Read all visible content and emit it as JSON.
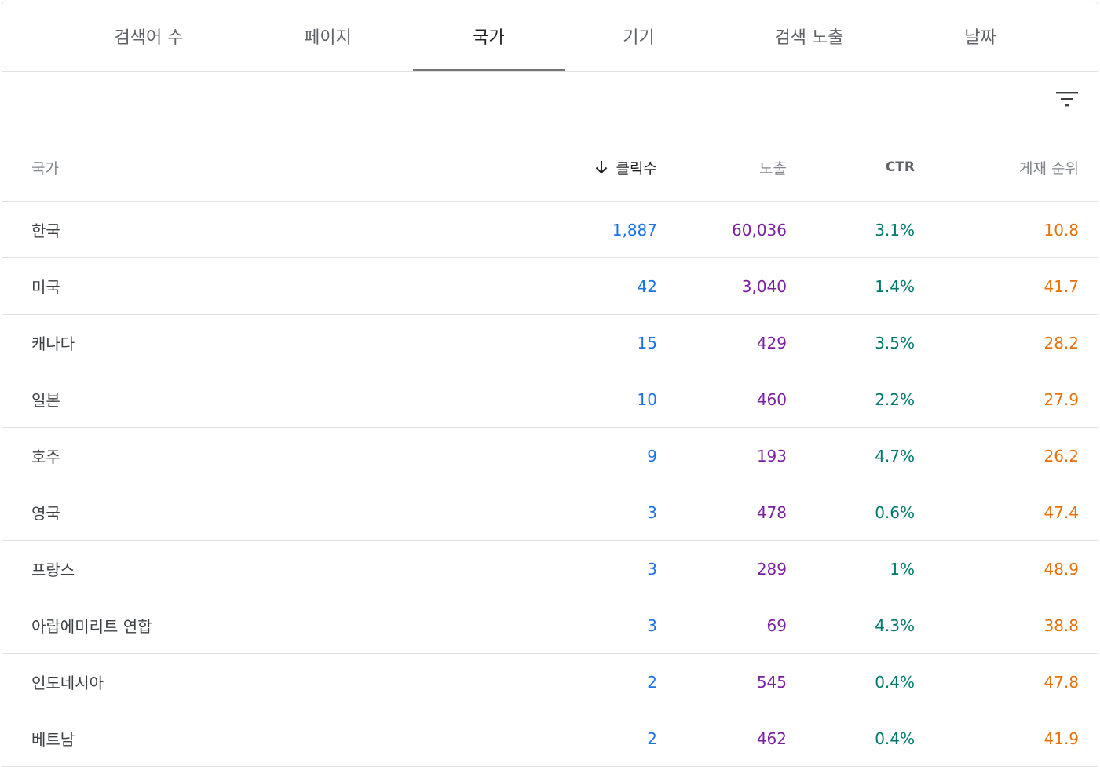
{
  "tabs": [
    {
      "label": "검색어 수",
      "active": false
    },
    {
      "label": "페이지",
      "active": false
    },
    {
      "label": "국가",
      "active": true
    },
    {
      "label": "기기",
      "active": false
    },
    {
      "label": "검색 노출",
      "active": false
    },
    {
      "label": "날짜",
      "active": false
    }
  ],
  "toolbar": {
    "filter_icon": "filter-icon"
  },
  "table": {
    "columns": {
      "country": "국가",
      "clicks": "클릭수",
      "impressions": "노출",
      "ctr": "CTR",
      "position": "게재 순위"
    },
    "sort": {
      "column": "clicks",
      "direction": "descending",
      "icon": "arrow-down-icon"
    },
    "rows": [
      {
        "country": "한국",
        "clicks": "1,887",
        "impressions": "60,036",
        "ctr": "3.1%",
        "position": "10.8"
      },
      {
        "country": "미국",
        "clicks": "42",
        "impressions": "3,040",
        "ctr": "1.4%",
        "position": "41.7"
      },
      {
        "country": "캐나다",
        "clicks": "15",
        "impressions": "429",
        "ctr": "3.5%",
        "position": "28.2"
      },
      {
        "country": "일본",
        "clicks": "10",
        "impressions": "460",
        "ctr": "2.2%",
        "position": "27.9"
      },
      {
        "country": "호주",
        "clicks": "9",
        "impressions": "193",
        "ctr": "4.7%",
        "position": "26.2"
      },
      {
        "country": "영국",
        "clicks": "3",
        "impressions": "478",
        "ctr": "0.6%",
        "position": "47.4"
      },
      {
        "country": "프랑스",
        "clicks": "3",
        "impressions": "289",
        "ctr": "1%",
        "position": "48.9"
      },
      {
        "country": "아랍에미리트 연합",
        "clicks": "3",
        "impressions": "69",
        "ctr": "4.3%",
        "position": "38.8"
      },
      {
        "country": "인도네시아",
        "clicks": "2",
        "impressions": "545",
        "ctr": "0.4%",
        "position": "47.8"
      },
      {
        "country": "베트남",
        "clicks": "2",
        "impressions": "462",
        "ctr": "0.4%",
        "position": "41.9"
      }
    ]
  },
  "colors": {
    "clicks": "#1a73e8",
    "impressions": "#7b1fa2",
    "ctr": "#00796b",
    "position": "#e8710a",
    "tab_indicator": "#757575"
  }
}
